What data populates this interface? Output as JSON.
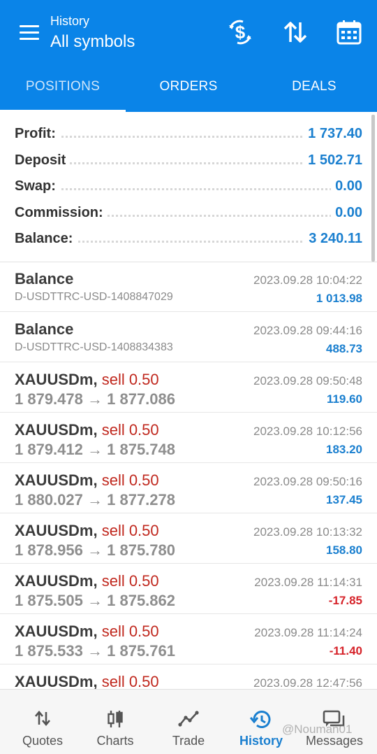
{
  "header": {
    "subtitle": "History",
    "title": "All symbols"
  },
  "toolbar_icons": [
    "currency-exchange-icon",
    "sort-icon",
    "calendar-icon"
  ],
  "tabs": [
    {
      "label": "POSITIONS",
      "active": true
    },
    {
      "label": "ORDERS",
      "active": false
    },
    {
      "label": "DEALS",
      "active": false
    }
  ],
  "summary": [
    {
      "label": "Profit:",
      "value": "1 737.40"
    },
    {
      "label": "Deposit",
      "value": "1 502.71"
    },
    {
      "label": "Swap:",
      "value": "0.00"
    },
    {
      "label": "Commission:",
      "value": "0.00"
    },
    {
      "label": "Balance:",
      "value": "3 240.11"
    }
  ],
  "rows": [
    {
      "title": "Balance",
      "sub": "D-USDTTRC-USD-1408847029",
      "date": "2023.09.28 10:04:22",
      "value": "1 013.98",
      "sign": "pos"
    },
    {
      "title": "Balance",
      "sub": "D-USDTTRC-USD-1408834383",
      "date": "2023.09.28 09:44:16",
      "value": "488.73",
      "sign": "pos"
    },
    {
      "symbol": "XAUUSDm,",
      "side": "sell 0.50",
      "open": "1 879.478",
      "arrow": "→",
      "close": "1 877.086",
      "date": "2023.09.28 09:50:48",
      "value": "119.60",
      "sign": "pos"
    },
    {
      "symbol": "XAUUSDm,",
      "side": "sell 0.50",
      "open": "1 879.412",
      "arrow": "→",
      "close": "1 875.748",
      "date": "2023.09.28 10:12:56",
      "value": "183.20",
      "sign": "pos"
    },
    {
      "symbol": "XAUUSDm,",
      "side": "sell 0.50",
      "open": "1 880.027",
      "arrow": "→",
      "close": "1 877.278",
      "date": "2023.09.28 09:50:16",
      "value": "137.45",
      "sign": "pos"
    },
    {
      "symbol": "XAUUSDm,",
      "side": "sell 0.50",
      "open": "1 878.956",
      "arrow": "→",
      "close": "1 875.780",
      "date": "2023.09.28 10:13:32",
      "value": "158.80",
      "sign": "pos"
    },
    {
      "symbol": "XAUUSDm,",
      "side": "sell 0.50",
      "open": "1 875.505",
      "arrow": "→",
      "close": "1 875.862",
      "date": "2023.09.28 11:14:31",
      "value": "-17.85",
      "sign": "neg"
    },
    {
      "symbol": "XAUUSDm,",
      "side": "sell 0.50",
      "open": "1 875.533",
      "arrow": "→",
      "close": "1 875.761",
      "date": "2023.09.28 11:14:24",
      "value": "-11.40",
      "sign": "neg"
    },
    {
      "symbol": "XAUUSDm,",
      "side": "sell 0.50",
      "open": "",
      "arrow": "",
      "close": "",
      "date": "2023.09.28 12:47:56",
      "value": "",
      "sign": "pos"
    }
  ],
  "nav": [
    {
      "label": "Quotes",
      "icon": "quotes-icon",
      "active": false
    },
    {
      "label": "Charts",
      "icon": "charts-icon",
      "active": false
    },
    {
      "label": "Trade",
      "icon": "trade-icon",
      "active": false
    },
    {
      "label": "History",
      "icon": "history-icon",
      "active": true
    },
    {
      "label": "Messages",
      "icon": "messages-icon",
      "active": false
    }
  ],
  "watermark": "@Nouman01",
  "colors": {
    "brand_blue": "#0a84e8",
    "positive": "#1a7fcf",
    "negative": "#d6232a",
    "sell": "#c0281e"
  }
}
